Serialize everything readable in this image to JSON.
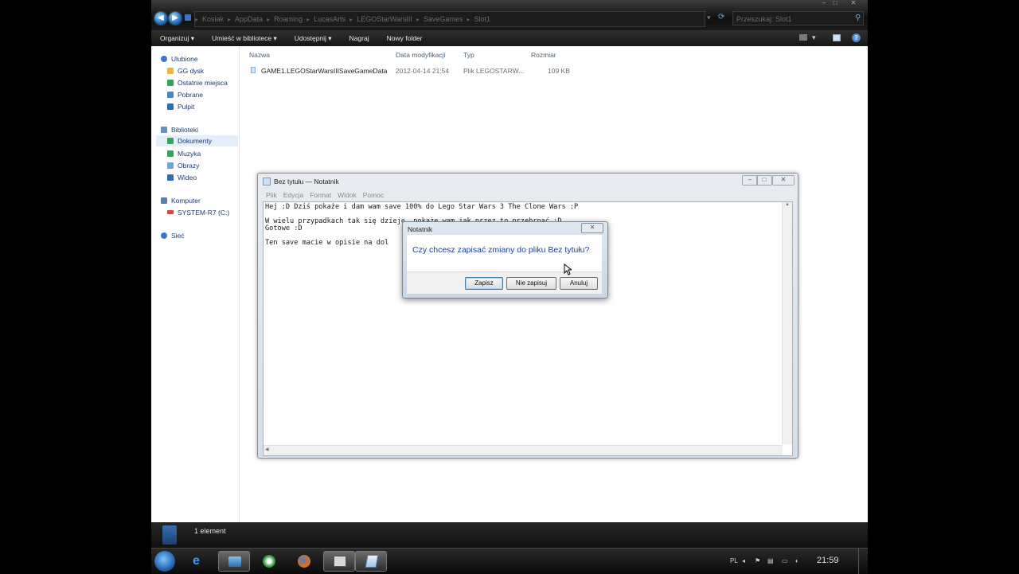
{
  "explorer": {
    "breadcrumb": [
      "Kosiak",
      "AppData",
      "Roaming",
      "LucasArts",
      "LEGOStarWarsIII",
      "SaveGames",
      "Slot1"
    ],
    "search_placeholder": "Przeszukaj: Slot1",
    "toolbar": [
      "Organizuj ▾",
      "Umieść w bibliotece ▾",
      "Udostępnij ▾",
      "Nagraj",
      "Nowy folder"
    ],
    "favorites": {
      "header": "Ulubione",
      "items": [
        "GG dysk",
        "Ostatnie miejsca",
        "Pobrane",
        "Pulpit"
      ]
    },
    "libraries": {
      "header": "Biblioteki",
      "items": [
        "Dokumenty",
        "Muzyka",
        "Obrazy",
        "Wideo"
      ]
    },
    "computer": {
      "header": "Komputer",
      "drive": "SYSTEM-R7 (C:)"
    },
    "network": "Sieć",
    "columns": [
      "Nazwa",
      "Data modyfikacji",
      "Typ",
      "Rozmiar"
    ],
    "files": [
      {
        "name": "GAME1.LEGOStarWarsIIISaveGameData",
        "date": "2012-04-14 21:54",
        "type": "Plik LEGOSTARW...",
        "size": "109 KB"
      }
    ],
    "status": "1 element"
  },
  "notepad": {
    "title": "Bez tytułu — Notatnik",
    "menu": [
      "Plik",
      "Edycja",
      "Format",
      "Widok",
      "Pomoc"
    ],
    "lines": [
      "Hej :D Dziś pokaże i dam wam save 100% do Lego Star Wars 3 The Clone Wars :P",
      "W wielu przypadkach tak się dzieje, pokaże wam jak przez to przebrnąć :D",
      "Gotowe :D",
      "Ten save macie w opisie na dol"
    ]
  },
  "dialog": {
    "title": "Notatnik",
    "message": "Czy chcesz zapisać zmiany do pliku Bez tytułu?",
    "buttons": {
      "save": "Zapisz",
      "dont_save": "Nie zapisuj",
      "cancel": "Anuluj"
    }
  },
  "taskbar": {
    "lang": "PL",
    "clock": "21:59"
  },
  "colors": {
    "accent": "#1c3ea0",
    "explorer_chrome": "#1a1a1a"
  }
}
